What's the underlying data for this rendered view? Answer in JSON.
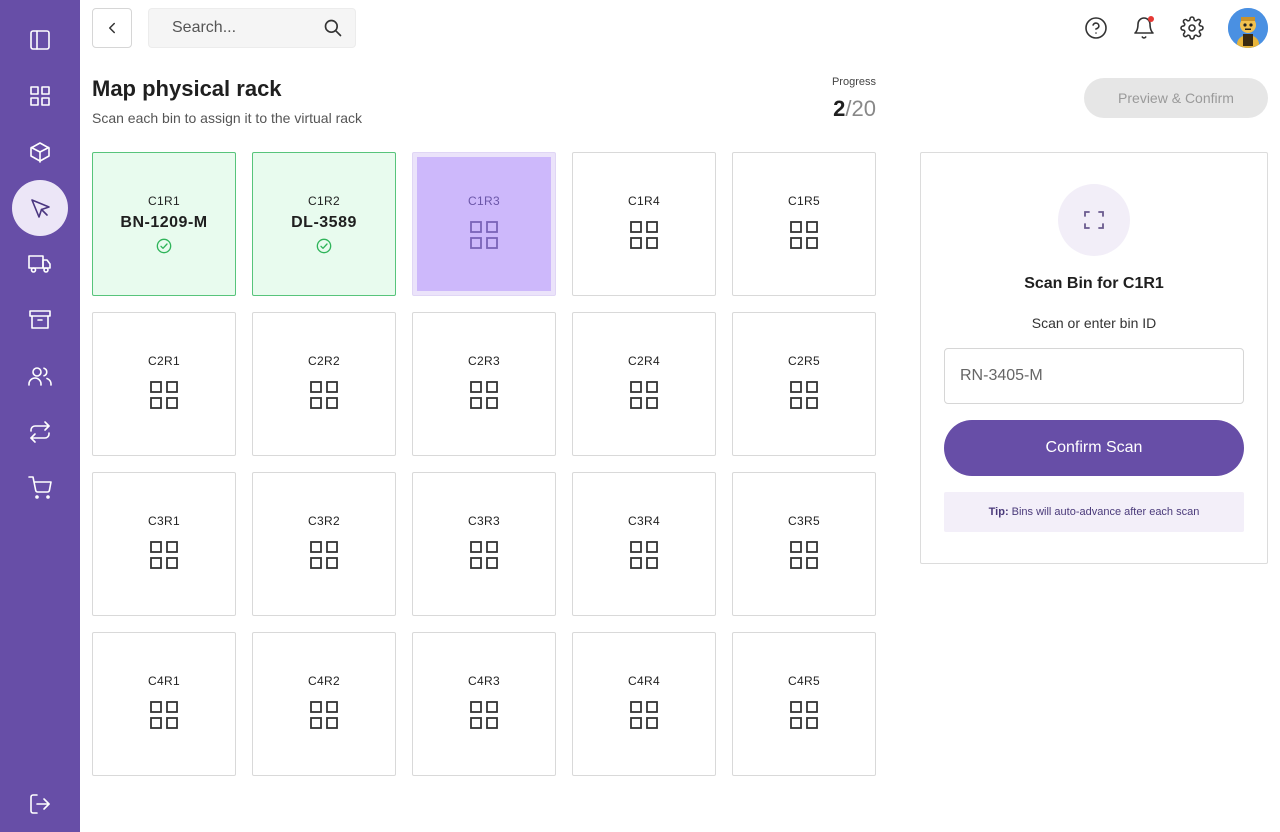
{
  "search": {
    "placeholder": "Search..."
  },
  "page": {
    "title": "Map physical rack",
    "subtitle": "Scan each bin to assign it to the virtual rack"
  },
  "progress": {
    "label": "Progress",
    "current": "2",
    "total": "/20"
  },
  "actions": {
    "preview_label": "Preview & Confirm"
  },
  "bins": [
    {
      "code": "C1R1",
      "status": "done",
      "bin_id": "BN-1209-M"
    },
    {
      "code": "C1R2",
      "status": "done",
      "bin_id": "DL-3589"
    },
    {
      "code": "C1R3",
      "status": "active"
    },
    {
      "code": "C1R4",
      "status": "empty"
    },
    {
      "code": "C1R5",
      "status": "empty"
    },
    {
      "code": "C2R1",
      "status": "empty"
    },
    {
      "code": "C2R2",
      "status": "empty"
    },
    {
      "code": "C2R3",
      "status": "empty"
    },
    {
      "code": "C2R4",
      "status": "empty"
    },
    {
      "code": "C2R5",
      "status": "empty"
    },
    {
      "code": "C3R1",
      "status": "empty"
    },
    {
      "code": "C3R2",
      "status": "empty"
    },
    {
      "code": "C3R3",
      "status": "empty"
    },
    {
      "code": "C3R4",
      "status": "empty"
    },
    {
      "code": "C3R5",
      "status": "empty"
    },
    {
      "code": "C4R1",
      "status": "empty"
    },
    {
      "code": "C4R2",
      "status": "empty"
    },
    {
      "code": "C4R3",
      "status": "empty"
    },
    {
      "code": "C4R4",
      "status": "empty"
    },
    {
      "code": "C4R5",
      "status": "empty"
    }
  ],
  "scan_panel": {
    "title": "Scan Bin for C1R1",
    "subtitle": "Scan or enter bin ID",
    "input_placeholder": "RN-3405-M",
    "confirm_label": "Confirm Scan",
    "tip_strong": "Tip:",
    "tip_text": "Bins will auto-advance after each scan"
  },
  "icons": {
    "sidebar": [
      "sidebar-panel-icon",
      "dashboard-grid-icon",
      "box-icon",
      "cursor-pointer-icon",
      "truck-icon",
      "archive-icon",
      "users-icon",
      "transfer-arrows-icon",
      "cart-icon",
      "logout-icon"
    ],
    "top": [
      "help-icon",
      "bell-icon",
      "gear-icon"
    ]
  },
  "colors": {
    "sidebar": "#674ea7",
    "accent": "#674ea7",
    "done_bg": "#e8fbee",
    "done_border": "#57c47b",
    "active_bin": "#cdb8fb",
    "notification_dot": "#e53935"
  }
}
